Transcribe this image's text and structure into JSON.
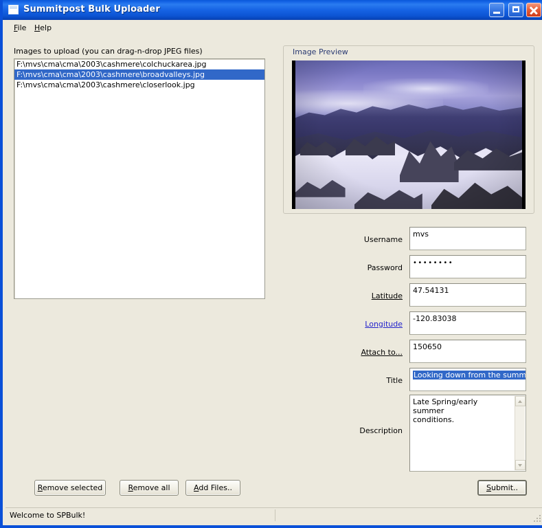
{
  "window": {
    "title": "Summitpost Bulk Uploader",
    "icon": "app-icon",
    "controls": {
      "minimize": "minimize-icon",
      "maximize": "maximize-icon",
      "close": "close-icon"
    }
  },
  "menu": {
    "items": [
      {
        "label": "File",
        "mnemonic": "F",
        "rest": "ile"
      },
      {
        "label": "Help",
        "mnemonic": "H",
        "rest": "elp"
      }
    ]
  },
  "list_section": {
    "label": "Images to upload (you can drag-n-drop JPEG files)",
    "files": [
      {
        "path": "F:\\mvs\\cma\\cma\\2003\\cashmere\\colchuckarea.jpg",
        "selected": false
      },
      {
        "path": "F:\\mvs\\cma\\cma\\2003\\cashmere\\broadvalleys.jpg",
        "selected": true
      },
      {
        "path": "F:\\mvs\\cma\\cma\\2003\\cashmere\\closerlook.jpg",
        "selected": false
      }
    ]
  },
  "list_buttons": [
    {
      "mnemonic": "R",
      "rest": "emove selected",
      "label": "Remove selected"
    },
    {
      "mnemonic": "R",
      "rest": "emove all",
      "label": "Remove all"
    },
    {
      "mnemonic": "A",
      "rest": "dd Files..",
      "label": "Add Files.."
    }
  ],
  "preview": {
    "legend": "Image Preview",
    "image_alt": "mountain-photo"
  },
  "form": {
    "username": {
      "label": "Username",
      "value": "mvs",
      "style": "plain"
    },
    "password": {
      "label": "Password",
      "value": "••••••••",
      "style": "plain"
    },
    "latitude": {
      "label": "Latitude",
      "value": "47.54131",
      "style": "link-dark"
    },
    "longitude": {
      "label": "Longitude",
      "value": "-120.83038",
      "style": "link-blue"
    },
    "attach_to": {
      "label": "Attach to...",
      "value": "150650",
      "style": "link-dark"
    },
    "title": {
      "label": "Title",
      "value": "Looking down from the summit",
      "style": "plain",
      "selected": true
    },
    "description": {
      "label": "Description",
      "value": "Late Spring/early summer\nconditions."
    }
  },
  "submit_button": {
    "mnemonic": "S",
    "rest": "ubmit..",
    "label": "Submit.."
  },
  "status": {
    "text": "Welcome to SPBulk!"
  },
  "colors": {
    "titlebar_blue": "#0a50d8",
    "window_bg": "#ece9dd",
    "selection_blue": "#3168c8",
    "link_blue": "#2222cc",
    "legend_navy": "#2a3a72"
  }
}
